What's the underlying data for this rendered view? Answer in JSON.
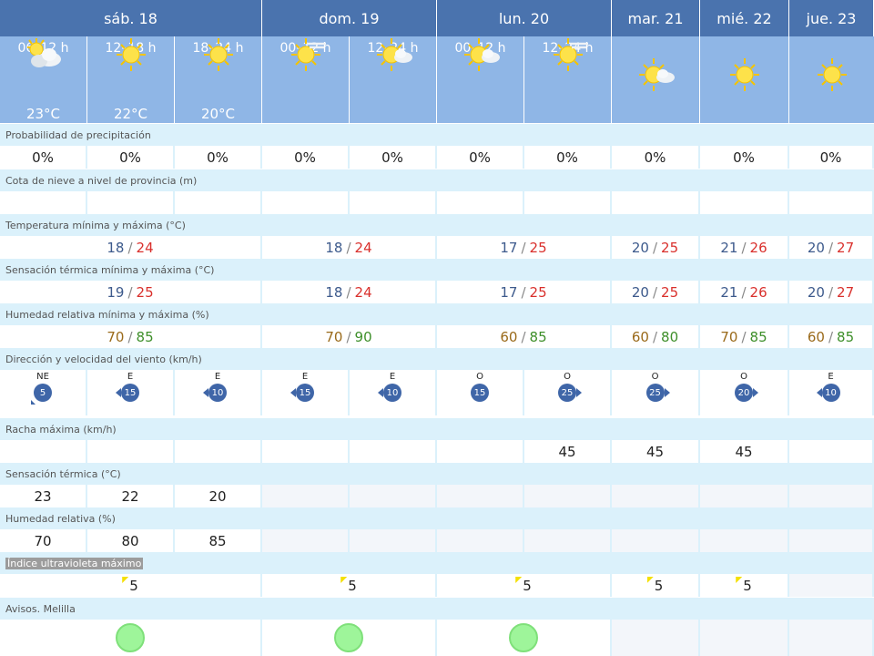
{
  "days": [
    {
      "label": "sáb. 18",
      "periods": [
        {
          "time": "06–12 h",
          "temp": "23°C",
          "icon": "partly-cloudy-icon"
        },
        {
          "time": "12–18 h",
          "temp": "22°C",
          "icon": "sun-icon"
        },
        {
          "time": "18–24 h",
          "temp": "20°C",
          "icon": "sun-icon"
        }
      ]
    },
    {
      "label": "dom. 19",
      "periods": [
        {
          "time": "00–12 h",
          "temp": "",
          "icon": "sun-haze-icon"
        },
        {
          "time": "12–24 h",
          "temp": "",
          "icon": "sun-cloud-icon"
        }
      ]
    },
    {
      "label": "lun. 20",
      "periods": [
        {
          "time": "00–12 h",
          "temp": "",
          "icon": "sun-cloud-icon"
        },
        {
          "time": "12–24 h",
          "temp": "",
          "icon": "sun-haze-icon"
        }
      ]
    },
    {
      "label": "mar. 21",
      "periods": [
        {
          "time": "",
          "temp": "",
          "icon": "sun-cloud-icon"
        }
      ]
    },
    {
      "label": "mié. 22",
      "periods": [
        {
          "time": "",
          "temp": "",
          "icon": "sun-icon"
        }
      ]
    },
    {
      "label": "jue. 23",
      "periods": [
        {
          "time": "",
          "temp": "",
          "icon": "sun-icon"
        }
      ]
    }
  ],
  "labels": {
    "precip": "Probabilidad de precipitación",
    "snow": "Cota de nieve a nivel de provincia (m)",
    "temp": "Temperatura mínima y máxima (°C)",
    "sens": "Sensación térmica mínima y máxima (°C)",
    "hum": "Humedad relativa mínima y máxima (%)",
    "wind": "Dirección y velocidad del viento (km/h)",
    "gust": "Racha máxima (km/h)",
    "sens_term": "Sensación térmica (°C)",
    "hum_rel": "Humedad relativa (%)",
    "uv": "Índice ultravioleta máximo",
    "avisos": "Avisos. Melilla"
  },
  "precip": [
    "0%",
    "0%",
    "0%",
    "0%",
    "0%",
    "0%",
    "0%",
    "0%",
    "0%",
    "0%"
  ],
  "temp_minmax": [
    {
      "min": "18",
      "max": "24"
    },
    {
      "min": "18",
      "max": "24"
    },
    {
      "min": "17",
      "max": "25"
    },
    {
      "min": "20",
      "max": "25"
    },
    {
      "min": "21",
      "max": "26"
    },
    {
      "min": "20",
      "max": "27"
    }
  ],
  "sens_minmax": [
    {
      "min": "19",
      "max": "25"
    },
    {
      "min": "18",
      "max": "24"
    },
    {
      "min": "17",
      "max": "25"
    },
    {
      "min": "20",
      "max": "25"
    },
    {
      "min": "21",
      "max": "26"
    },
    {
      "min": "20",
      "max": "27"
    }
  ],
  "hum_minmax": [
    {
      "min": "70",
      "max": "85"
    },
    {
      "min": "70",
      "max": "90"
    },
    {
      "min": "60",
      "max": "85"
    },
    {
      "min": "60",
      "max": "80"
    },
    {
      "min": "70",
      "max": "85"
    },
    {
      "min": "60",
      "max": "85"
    }
  ],
  "wind": [
    {
      "dir": "NE",
      "speed": "5",
      "arrow": "sw"
    },
    {
      "dir": "E",
      "speed": "15",
      "arrow": "left"
    },
    {
      "dir": "E",
      "speed": "10",
      "arrow": "left"
    },
    {
      "dir": "E",
      "speed": "15",
      "arrow": "left"
    },
    {
      "dir": "E",
      "speed": "10",
      "arrow": "left"
    },
    {
      "dir": "O",
      "speed": "15",
      "arrow": "none"
    },
    {
      "dir": "O",
      "speed": "25",
      "arrow": "right"
    },
    {
      "dir": "O",
      "speed": "25",
      "arrow": "right"
    },
    {
      "dir": "O",
      "speed": "20",
      "arrow": "right"
    },
    {
      "dir": "E",
      "speed": "10",
      "arrow": "left"
    }
  ],
  "gust": [
    "",
    "",
    "",
    "",
    "",
    "",
    "45",
    "45",
    "45",
    ""
  ],
  "sens_term": [
    "23",
    "22",
    "20"
  ],
  "hum_rel": [
    "70",
    "80",
    "85"
  ],
  "uv": [
    "5",
    "5",
    "5",
    "5",
    "5",
    ""
  ],
  "colors": {
    "header_dark": "#4a73ae",
    "header_light": "#8fb6e6",
    "row_bg": "#dbf1fb",
    "min_temp": "#3d5a8c",
    "max_temp": "#d9302c",
    "hum_min": "#9a6a1a",
    "hum_max": "#3e8f2a",
    "warning_green": "#9ef59a"
  }
}
